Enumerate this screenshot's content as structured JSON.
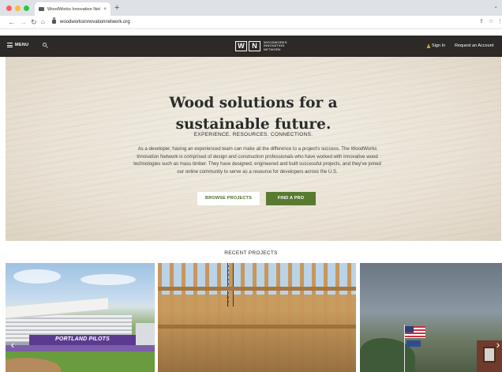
{
  "browser": {
    "tab_title": "WoodWorks Innovation Netwo",
    "tab_close": "×",
    "new_tab": "+",
    "url": "woodworksinnovationnetwork.org",
    "icons": [
      "back-icon",
      "forward-icon",
      "reload-icon",
      "home-icon",
      "lock-icon",
      "share-icon",
      "star-icon",
      "more-icon"
    ]
  },
  "header": {
    "menu_label": "MENU",
    "logo_letters": [
      "W",
      "N"
    ],
    "logo_lines": [
      "WOODWORKS",
      "INNOVATION",
      "NETWORK"
    ],
    "sign_in": "Sign In",
    "request_account": "Request an Account"
  },
  "hero": {
    "title": "Wood solutions for a sustainable future.",
    "tagline": "EXPERIENCE. RESOURCES. CONNECTIONS.",
    "body": "As a developer, having an experienced team can make all the difference to a project's success. The WoodWorks Innovation Network is comprised of design and construction professionals who have worked with innovative wood technologies such as mass timber. They have designed, engineered and built successful projects, and they've joined our online community to serve as a resource for developers across the U.S.",
    "browse_button": "BROWSE PROJECTS",
    "find_pro_button": "FIND A PRO"
  },
  "recent": {
    "title": "RECENT PROJECTS",
    "card1_banner": "PORTLAND PILOTS"
  },
  "colors": {
    "header_bg": "#2c2926",
    "accent_green": "#5a7a30",
    "pilots_purple": "#5b3a91"
  }
}
